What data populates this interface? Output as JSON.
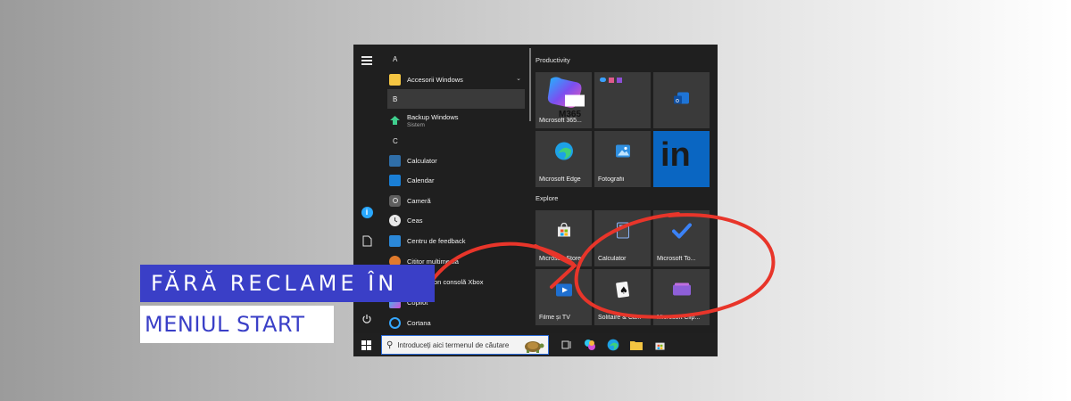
{
  "start_menu": {
    "letters": [
      "A",
      "B",
      "C"
    ],
    "apps": [
      {
        "name": "Accesorii Windows",
        "sub": ""
      },
      {
        "name": "Backup Windows",
        "sub": "Sistem"
      },
      {
        "name": "Calculator",
        "sub": ""
      },
      {
        "name": "Calendar",
        "sub": ""
      },
      {
        "name": "Cameră",
        "sub": ""
      },
      {
        "name": "Ceas",
        "sub": ""
      },
      {
        "name": "Centru de feedback",
        "sub": ""
      },
      {
        "name": "Cititor multimedia",
        "sub": ""
      },
      {
        "name": "Companion consolă Xbox",
        "sub": ""
      },
      {
        "name": "Copilot",
        "sub": ""
      },
      {
        "name": "Cortana",
        "sub": ""
      }
    ],
    "groups": [
      "Productivity",
      "Explore"
    ],
    "tiles": {
      "m365": "Microsoft 365...",
      "m365_logo": "M365",
      "edge": "Microsoft Edge",
      "photos": "Fotografii",
      "linkedin": "in",
      "store": "Microsoft Store",
      "calculator": "Calculator",
      "todo": "Microsoft To...",
      "movies": "Filme și TV",
      "solitaire": "Solitaire & Ca...",
      "clipchamp": "Microsoft Clip..."
    }
  },
  "taskbar": {
    "search_placeholder": "Introduceți aici termenul de căutare"
  },
  "banner": {
    "line1": "FĂRĂ RECLAME ÎN",
    "line2": "MENIUL START"
  },
  "colors": {
    "banner_blue": "#3a3fc7",
    "annotation_red": "#e8352a",
    "start_bg": "#1f1f1f",
    "tile_bg": "#3a3a3a"
  }
}
